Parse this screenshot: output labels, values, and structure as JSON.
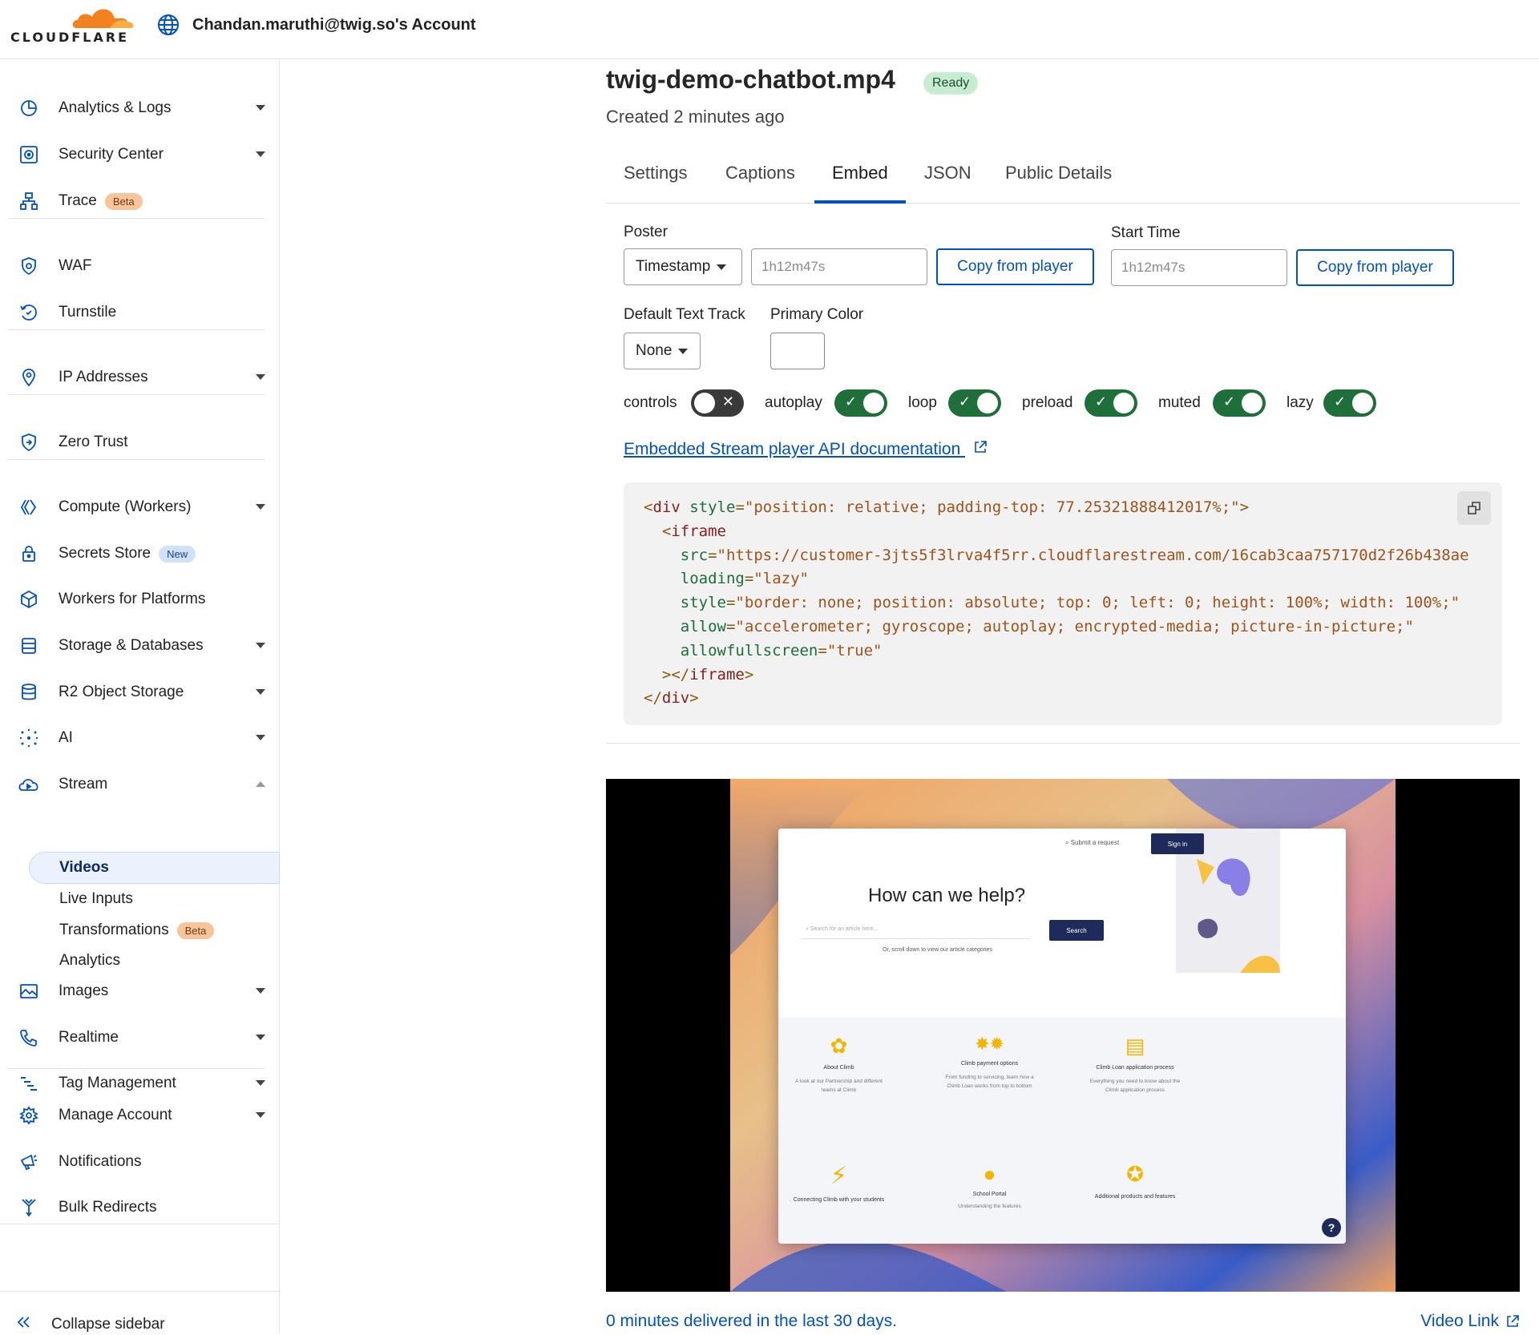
{
  "brand": {
    "wordmark": "CLOUDFLARE",
    "orange": "#f48120",
    "blue": "#0051c3"
  },
  "account": {
    "name": "Chandan.maruthi@twig.so's Account"
  },
  "sidebar": {
    "items": [
      {
        "label": "Analytics & Logs",
        "icon": "analytics-icon",
        "caret": true
      },
      {
        "label": "Security Center",
        "icon": "security-center-icon",
        "caret": true
      },
      {
        "label": "Trace",
        "icon": "trace-icon",
        "badge": "Beta"
      },
      {
        "label": "WAF",
        "icon": "waf-shield-icon"
      },
      {
        "label": "Turnstile",
        "icon": "turnstile-icon"
      },
      {
        "label": "IP Addresses",
        "icon": "location-pin-icon",
        "caret": true
      },
      {
        "label": "Zero Trust",
        "icon": "zero-trust-icon"
      },
      {
        "label": "Compute (Workers)",
        "icon": "workers-icon",
        "caret": true
      },
      {
        "label": "Secrets Store",
        "icon": "lock-icon",
        "badge": "New"
      },
      {
        "label": "Workers for Platforms",
        "icon": "cube-icon"
      },
      {
        "label": "Storage & Databases",
        "icon": "database-icon",
        "caret": true
      },
      {
        "label": "R2 Object Storage",
        "icon": "r2-storage-icon",
        "caret": true
      },
      {
        "label": "AI",
        "icon": "ai-sparkle-icon",
        "caret": true
      },
      {
        "label": "Stream",
        "icon": "stream-cloud-icon",
        "caret": true
      },
      {
        "label": "Images",
        "icon": "image-icon",
        "caret": true
      },
      {
        "label": "Realtime",
        "icon": "phone-icon",
        "caret": true
      },
      {
        "label": "Tag Management",
        "icon": "tag-management-icon",
        "caret": true
      },
      {
        "label": "Manage Account",
        "icon": "gear-icon",
        "caret": true
      },
      {
        "label": "Notifications",
        "icon": "megaphone-icon"
      },
      {
        "label": "Bulk Redirects",
        "icon": "redirect-icon"
      }
    ],
    "stream_sub": [
      {
        "label": "Videos",
        "active": true
      },
      {
        "label": "Live Inputs"
      },
      {
        "label": "Transformations",
        "badge": "Beta"
      },
      {
        "label": "Analytics"
      }
    ],
    "collapse_label": "Collapse sidebar"
  },
  "video": {
    "title": "twig-demo-chatbot.mp4",
    "status": "Ready",
    "created": "Created 2 minutes ago"
  },
  "tabs": [
    "Settings",
    "Captions",
    "Embed",
    "JSON",
    "Public Details"
  ],
  "active_tab": "Embed",
  "embed": {
    "poster_label": "Poster",
    "poster_mode": "Timestamp",
    "poster_time": "1h12m47s",
    "copy_from_player": "Copy from player",
    "start_time_label": "Start Time",
    "start_time": "1h12m47s",
    "text_track_label": "Default Text Track",
    "text_track": "None",
    "primary_color_label": "Primary Color",
    "primary_color": "#ffffff",
    "toggles": [
      {
        "label": "controls",
        "on": false
      },
      {
        "label": "autoplay",
        "on": true
      },
      {
        "label": "loop",
        "on": true
      },
      {
        "label": "preload",
        "on": true
      },
      {
        "label": "muted",
        "on": true
      },
      {
        "label": "lazy",
        "on": true
      }
    ],
    "doc_link": "Embedded Stream player API documentation",
    "code": {
      "padding_top": "77.25321888412017%",
      "src": "https://customer-3jts5f3lrva4f5rr.cloudflarestream.com/16cab3caa757170d2f26b438ae",
      "loading": "lazy",
      "style": "border: none; position: absolute; top: 0; left: 0; height: 100%; width: 100%;",
      "allow": "accelerometer; gyroscope; autoplay; encrypted-media; picture-in-picture;",
      "allowfullscreen": "true"
    }
  },
  "preview": {
    "search_link": "Submit a request",
    "signin": "Sign in",
    "heading": "How can we help?",
    "search_placeholder": "Search for an article here...",
    "search_button": "Search",
    "scroll_hint": "Or, scroll down to view our article categories",
    "cards": [
      {
        "title": "About Climb",
        "desc": "A look at our Partnership and different teams at Climb"
      },
      {
        "title": "Climb payment options",
        "desc": "From funding to servicing, learn how a Climb Loan works from top to bottom"
      },
      {
        "title": "Climb Loan application process",
        "desc": "Everything you need to know about the Climb application process"
      },
      {
        "title": "Connecting Climb with your students",
        "desc": ""
      },
      {
        "title": "School Portal",
        "desc": "Understanding the features"
      },
      {
        "title": "Additional products and features",
        "desc": ""
      }
    ],
    "help_glyph": "?"
  },
  "footer": {
    "delivered": "0 minutes delivered in the last 30 days.",
    "video_link": "Video Link"
  }
}
